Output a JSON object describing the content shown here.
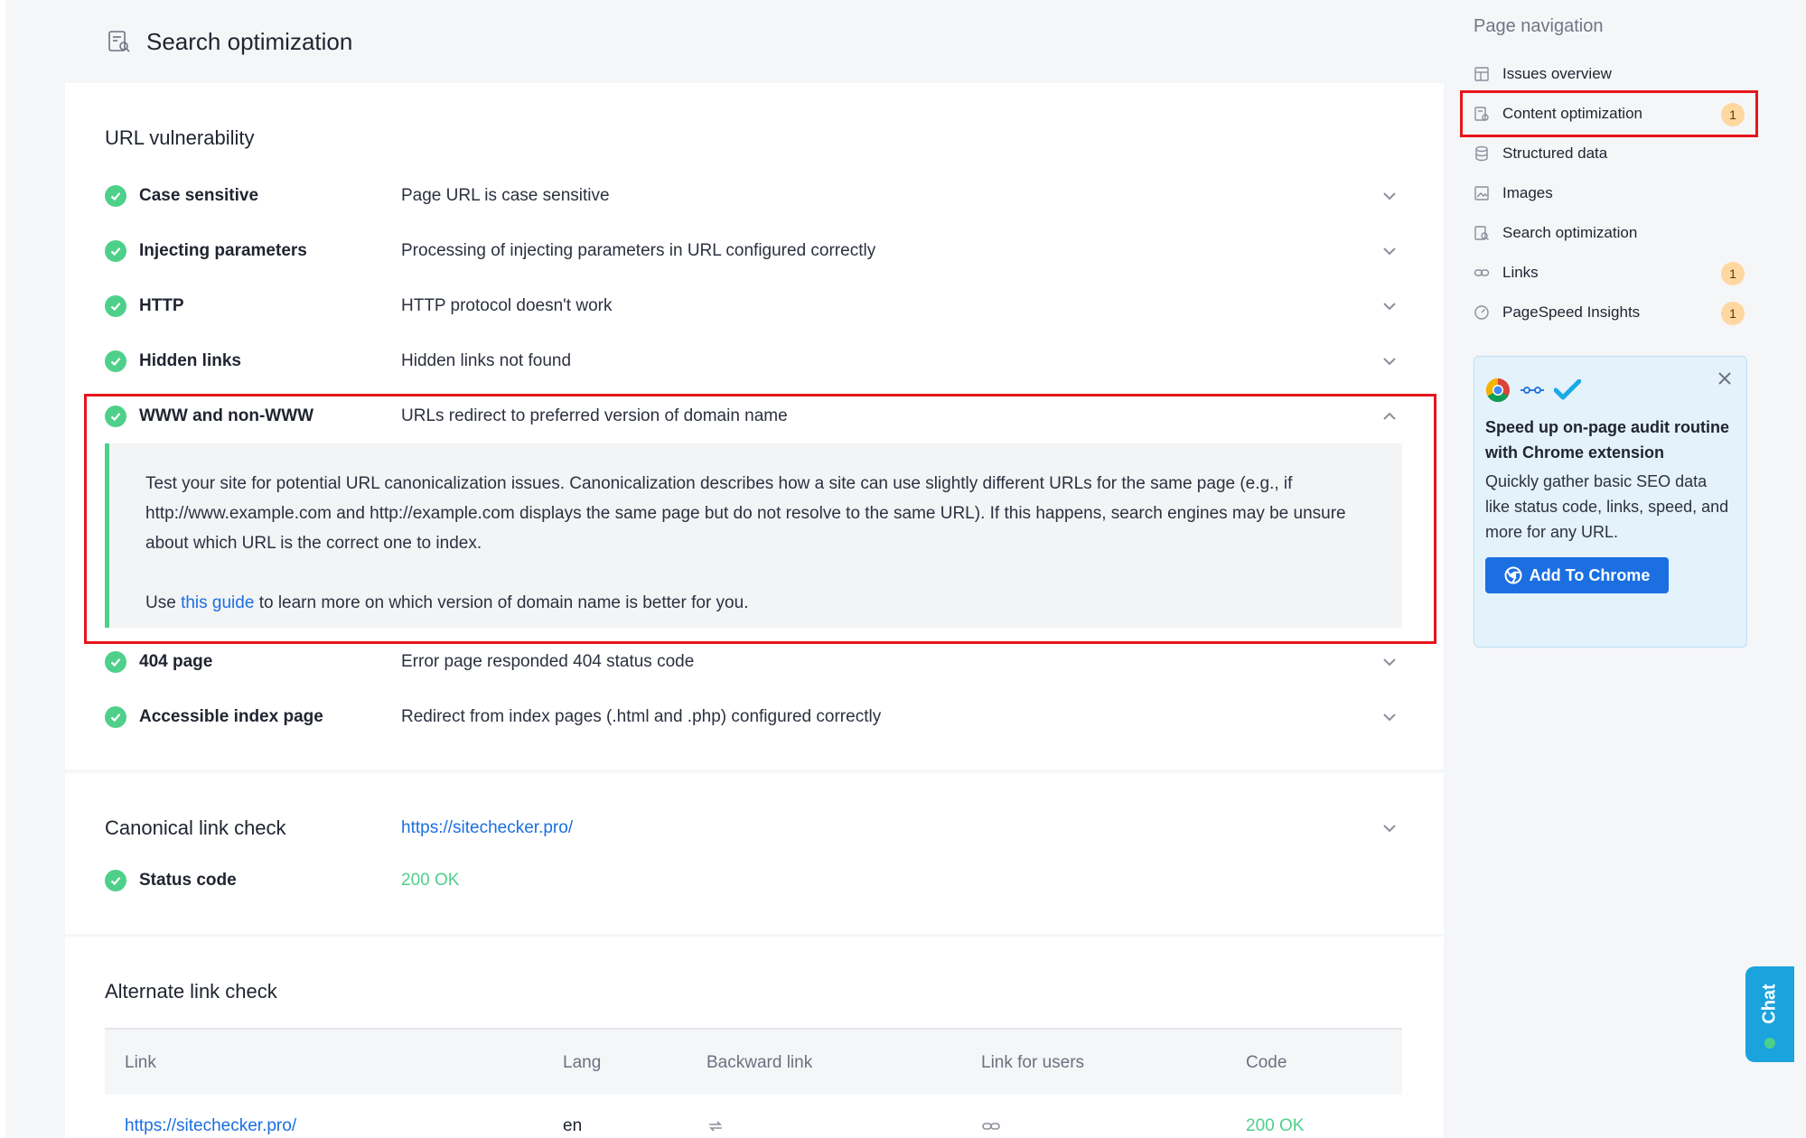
{
  "header": {
    "title": "Search optimization"
  },
  "url_vulnerability": {
    "title": "URL vulnerability",
    "rows": [
      {
        "name": "Case sensitive",
        "desc": "Page URL is case sensitive"
      },
      {
        "name": "Injecting parameters",
        "desc": "Processing of injecting parameters in URL configured correctly"
      },
      {
        "name": "HTTP",
        "desc": "HTTP protocol doesn't work"
      },
      {
        "name": "Hidden links",
        "desc": "Hidden links not found"
      },
      {
        "name": "WWW and non-WWW",
        "desc": "URLs redirect to preferred version of domain name"
      },
      {
        "name": "404 page",
        "desc": "Error page responded 404 status code"
      },
      {
        "name": "Accessible index page",
        "desc": "Redirect from index pages (.html and .php) configured correctly"
      }
    ],
    "expanded": {
      "paragraph1": "Test your site for potential URL canonicalization issues. Canonicalization describes how a site can use slightly different URLs for the same page (e.g., if http://www.example.com and http://example.com displays the same page but do not resolve to the same URL). If this happens, search engines may be unsure about which URL is the correct one to index.",
      "use_prefix": "Use",
      "guide_link": "this guide",
      "use_suffix": "to learn more on which version of domain name is better for you."
    }
  },
  "canonical": {
    "title": "Canonical link check",
    "url": "https://sitechecker.pro/",
    "status_label": "Status code",
    "status_value": "200 OK"
  },
  "alternate": {
    "title": "Alternate link check",
    "columns": [
      "Link",
      "Lang",
      "Backward link",
      "Link for users",
      "Code"
    ],
    "row": {
      "link": "https://sitechecker.pro/",
      "lang": "en",
      "code": "200 OK"
    }
  },
  "sidebar": {
    "heading": "Page navigation",
    "items": [
      {
        "label": "Issues overview",
        "badge": ""
      },
      {
        "label": "Content optimization",
        "badge": "1"
      },
      {
        "label": "Structured data",
        "badge": ""
      },
      {
        "label": "Images",
        "badge": ""
      },
      {
        "label": "Search optimization",
        "badge": ""
      },
      {
        "label": "Links",
        "badge": "1"
      },
      {
        "label": "PageSpeed Insights",
        "badge": "1"
      }
    ],
    "promo": {
      "title": "Speed up on-page audit routine with Chrome extension",
      "text": "Quickly gather basic SEO data like status code, links, speed, and more for any URL.",
      "button": "Add To Chrome"
    }
  },
  "chat": {
    "label": "Chat"
  },
  "colors": {
    "accent": "#1b6fe0",
    "success": "#4fd08a",
    "badge": "#ffd7a1",
    "highlight": "#e6151c"
  }
}
